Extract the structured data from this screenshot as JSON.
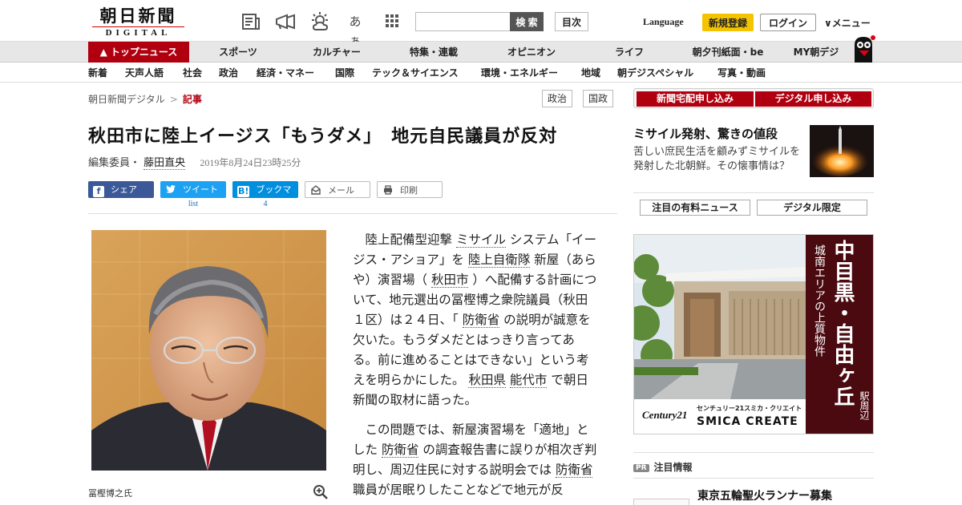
{
  "header": {
    "logo_main": "朝日新聞",
    "logo_sub": "DIGITAL",
    "search_label": "検 索",
    "toc_label": "目次",
    "language": "Language",
    "register": "新規登録",
    "login": "ログイン",
    "menu": "メニュー",
    "font_size_glyph": "あぁ",
    "icons": [
      "newspaper-icon",
      "megaphone-icon",
      "weather-icon",
      "font-size-icon",
      "grid-icon"
    ]
  },
  "main_nav": [
    {
      "label": "トップニュース"
    },
    {
      "label": "スポーツ"
    },
    {
      "label": "カルチャー"
    },
    {
      "label": "特集・連載"
    },
    {
      "label": "オピニオン"
    },
    {
      "label": "ライフ"
    },
    {
      "label": "朝夕刊紙面・be"
    },
    {
      "label": "MY朝デジ"
    }
  ],
  "sub_nav": [
    {
      "label": "新着"
    },
    {
      "label": "天声人語"
    },
    {
      "label": "社会"
    },
    {
      "label": "政治"
    },
    {
      "label": "経済・マネー"
    },
    {
      "label": "国際"
    },
    {
      "label": "テック＆サイエンス"
    },
    {
      "label": "環境・エネルギー"
    },
    {
      "label": "地域"
    },
    {
      "label": "朝デジスペシャル"
    },
    {
      "label": "写真・動画"
    }
  ],
  "breadcrumb": {
    "home": "朝日新聞デジタル",
    "sep": ">",
    "current": "記事"
  },
  "tags": [
    "政治",
    "国政"
  ],
  "article": {
    "headline": "秋田市に陸上イージス「もうダメ」　地元自民議員が反対",
    "byline_role": "編集委員・",
    "author": "藤田直央",
    "date": "2019年8月24日23時25分",
    "share": {
      "facebook": "シェア",
      "twitter": "ツイート",
      "twitter_count": "list",
      "hatena": "ブックマーク",
      "hatena_count": "4",
      "mail": "メール",
      "print": "印刷"
    },
    "photo_caption": "冨樫博之氏",
    "p1": {
      "a": "陸上配備型迎撃",
      "b": "ミサイル",
      "c": "システム「イージス・アショア」を",
      "d": "陸上自衛隊",
      "e": "新屋（あらや）演習場（",
      "f": "秋田市",
      "g": "）へ配備する計画について、地元選出の冨樫博之衆院議員（秋田１区）は２４日、「",
      "h": "防衛省",
      "i": "の説明が誠意を欠いた。もうダメだとはっきり言ってある。前に進めることはできない」という考えを明らかにした。",
      "j": "秋田県",
      "k": "能代市",
      "l": "で朝日新聞の取材に語った。"
    },
    "p2": {
      "a": "この問題では、新屋演習場を「適地」とした",
      "b": "防衛省",
      "c": "の調査報告書に誤りが相次ぎ判明し、周辺住民に対する説明会では",
      "d": "防衛省",
      "e": "職員が居眠りしたことなどで地元が反"
    }
  },
  "sidebar": {
    "apply_delivery": "新聞宅配申し込み",
    "apply_digital": "デジタル申し込み",
    "special_title": "ミサイル発射、驚きの値段",
    "special_desc": "苦しい庶民生活を顧みずミサイルを発射した北朝鮮。その懐事情は？",
    "btn_paid_news": "注目の有料ニュース",
    "btn_digital_only": "デジタル限定",
    "ad": {
      "col1": "城南エリアの上質物件",
      "col2": "中目黒・自由ヶ丘",
      "col3": "駅周辺",
      "brand": "Century21",
      "brand_jp": "センチュリー21スミカ・クリエイト",
      "brand_en": "SMICA CREATE"
    },
    "pr_badge": "PR",
    "pr_heading": "注目情報",
    "pr_title": "東京五輪聖火ランナー募集"
  },
  "colors": {
    "brand_red": "#b00010",
    "register_yellow": "#f5c400",
    "facebook": "#3b5998",
    "twitter": "#1da1f2",
    "hatena": "#008fde"
  }
}
